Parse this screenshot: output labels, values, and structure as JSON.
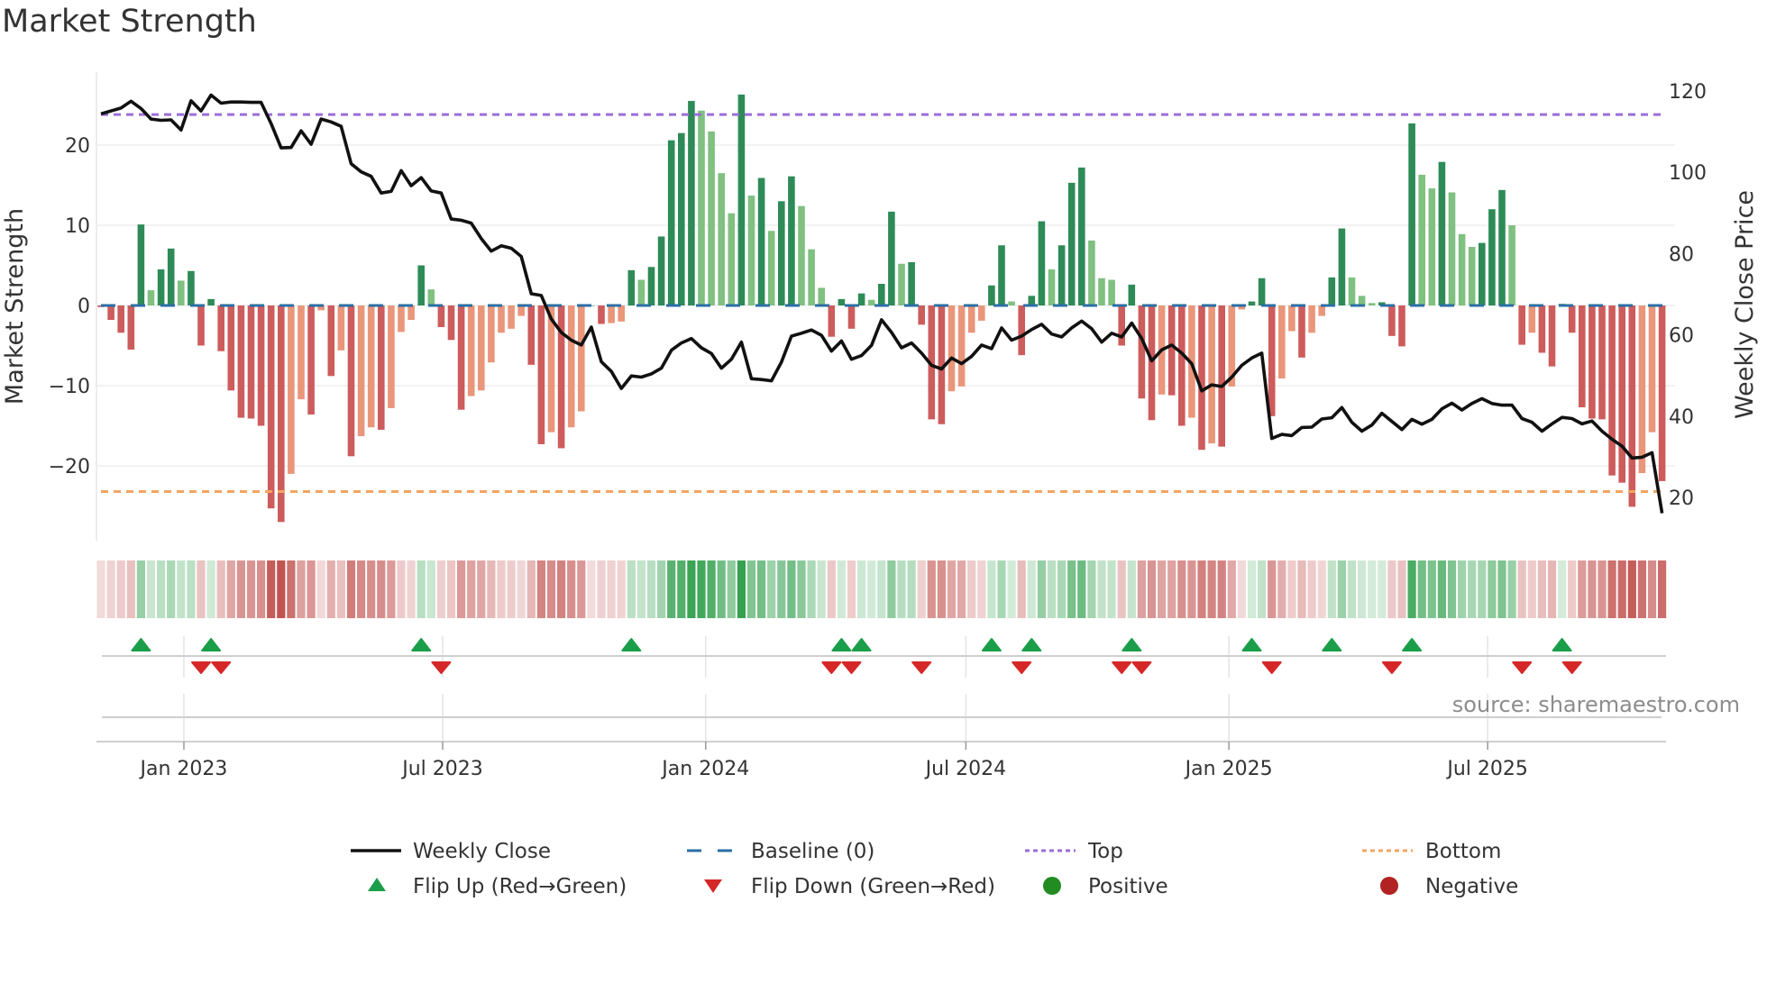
{
  "chart_data": {
    "type": "bar+line",
    "title": "Market Strength",
    "start_date": "2022-11-04",
    "frequency": "weekly",
    "left_axis": {
      "label": "Market Strength",
      "ticks": [
        20,
        10,
        0,
        -10,
        -20
      ],
      "tick_labels": [
        "20",
        "10",
        "0",
        "−10",
        "−20"
      ],
      "range": [
        -28.5,
        29.5
      ]
    },
    "right_axis": {
      "label": "Weekly Close Price",
      "ticks": [
        120,
        100,
        80,
        60,
        40,
        20
      ],
      "tick_labels": [
        "120",
        "100",
        "80",
        "60",
        "40",
        "20"
      ]
    },
    "x_ticks": [
      {
        "label": "Jan 2023",
        "date": "2023-01-01"
      },
      {
        "label": "Jul 2023",
        "date": "2023-07-01"
      },
      {
        "label": "Jan 2024",
        "date": "2024-01-01"
      },
      {
        "label": "Jul 2024",
        "date": "2024-07-01"
      },
      {
        "label": "Jan 2025",
        "date": "2025-01-01"
      },
      {
        "label": "Jul 2025",
        "date": "2025-07-01"
      }
    ],
    "top_level": 23.8,
    "bottom_level": -23.2,
    "baseline": 0,
    "strength": [
      -0.2,
      -1.8,
      -3.4,
      -5.5,
      10.1,
      1.9,
      4.5,
      7.1,
      3.1,
      4.3,
      -5.0,
      0.8,
      -5.7,
      -10.6,
      -14.0,
      -14.1,
      -15.0,
      -25.3,
      -27.0,
      -21.0,
      -11.7,
      -13.6,
      -0.6,
      -8.8,
      -5.6,
      -18.8,
      -16.3,
      -15.2,
      -15.5,
      -12.8,
      -3.3,
      -1.8,
      5.0,
      2.0,
      -2.7,
      -4.3,
      -13.0,
      -11.3,
      -10.6,
      -7.1,
      -3.4,
      -2.9,
      -1.3,
      -7.4,
      -17.3,
      -15.8,
      -17.8,
      -15.2,
      -13.2,
      0,
      -2.3,
      -2.2,
      -2.0,
      4.4,
      3.2,
      4.8,
      8.6,
      20.6,
      21.5,
      25.5,
      24.3,
      21.7,
      16.5,
      11.5,
      26.3,
      13.7,
      15.9,
      9.3,
      13.0,
      16.1,
      12.4,
      7.0,
      2.2,
      -3.9,
      0.8,
      -2.9,
      1.5,
      0.7,
      2.7,
      11.7,
      5.2,
      5.4,
      -2.4,
      -14.2,
      -14.8,
      -10.7,
      -10.1,
      -3.4,
      -1.9,
      2.5,
      7.5,
      0.5,
      -6.2,
      1.2,
      10.5,
      4.5,
      7.5,
      15.3,
      17.2,
      8.1,
      3.4,
      3.2,
      -5.0,
      2.6,
      -11.6,
      -14.3,
      -11.1,
      -11.2,
      -15.0,
      -14.0,
      -18.0,
      -17.2,
      -17.6,
      -10.1,
      -0.5,
      0.5,
      3.4,
      -13.8,
      -9.1,
      -3.2,
      -6.5,
      -3.4,
      -1.3,
      3.5,
      9.6,
      3.5,
      1.2,
      0.3,
      0.4,
      -3.8,
      -5.1,
      22.7,
      16.3,
      14.6,
      17.9,
      14.1,
      8.9,
      7.3,
      7.8,
      12.0,
      14.4,
      10.0,
      -4.9,
      -3.4,
      -5.9,
      -7.6,
      0.2,
      -3.4,
      -12.7,
      -14.1,
      -14.2,
      -21.2,
      -22.1,
      -25.1,
      -20.9,
      -15.8,
      -21.9
    ],
    "weekly_close": [
      114.4,
      115.1,
      115.8,
      117.5,
      115.7,
      113.1,
      112.8,
      112.9,
      110.4,
      117.6,
      115.1,
      119.0,
      117.0,
      117.3,
      117.3,
      117.2,
      117.2,
      112.0,
      106.0,
      106.1,
      110.2,
      106.9,
      113.1,
      112.4,
      111.3,
      102.1,
      100.1,
      99.0,
      94.9,
      95.3,
      100.4,
      96.7,
      98.7,
      95.4,
      94.9,
      88.5,
      88.2,
      87.5,
      83.7,
      80.6,
      81.9,
      81.3,
      79.3,
      70.1,
      69.7,
      63.9,
      60.6,
      58.7,
      57.5,
      61.9,
      53.4,
      51.0,
      46.8,
      49.9,
      49.6,
      50.4,
      51.8,
      56.2,
      58.0,
      59.1,
      56.8,
      55.4,
      51.8,
      54.0,
      58.2,
      49.2,
      49.0,
      48.7,
      53.3,
      59.7,
      60.4,
      61.2,
      59.9,
      56.0,
      58.5,
      54.0,
      54.9,
      57.4,
      63.7,
      60.6,
      56.8,
      58.0,
      55.5,
      52.5,
      51.6,
      54.3,
      52.9,
      54.7,
      57.5,
      56.6,
      61.7,
      58.7,
      59.7,
      61.3,
      62.6,
      60.2,
      59.5,
      61.7,
      63.4,
      61.5,
      58.2,
      60.4,
      59.5,
      62.9,
      59.1,
      53.6,
      56.3,
      57.5,
      55.5,
      52.9,
      46.2,
      47.7,
      47.3,
      49.6,
      52.5,
      54.3,
      55.5,
      34.5,
      35.5,
      35.2,
      37.2,
      37.3,
      39.3,
      39.6,
      42.1,
      38.5,
      36.3,
      37.8,
      40.7,
      38.7,
      36.7,
      39.2,
      38.0,
      39.2,
      41.8,
      43.2,
      41.5,
      43.1,
      44.3,
      43.1,
      42.7,
      42.7,
      39.4,
      38.5,
      36.3,
      38.1,
      39.7,
      39.4,
      38.1,
      38.8,
      36.3,
      34.3,
      32.6,
      29.7,
      29.9,
      31.0,
      16.1
    ],
    "legend": {
      "weekly_close": "Weekly Close",
      "baseline": "Baseline (0)",
      "top": "Top",
      "bottom": "Bottom",
      "flip_up": "Flip Up (Red→Green)",
      "flip_down": "Flip Down (Green→Red)",
      "positive": "Positive",
      "negative": "Negative"
    },
    "colors": {
      "rising_positive": "#2e8b57",
      "falling_positive": "#80c080",
      "falling_negative": "#cd5c5c",
      "rising_negative": "#e9967a",
      "line": "#111111",
      "baseline": "#2b6fa5",
      "top": "#9b6ddb",
      "bottom": "#f4a460",
      "flip_up": "#1a9e4a",
      "flip_down": "#d62728",
      "positive": "#228b22",
      "negative": "#b22222",
      "heat_green": "#2e9e4a",
      "heat_red": "#c0504d"
    }
  },
  "source": "source: sharemaestro.com"
}
